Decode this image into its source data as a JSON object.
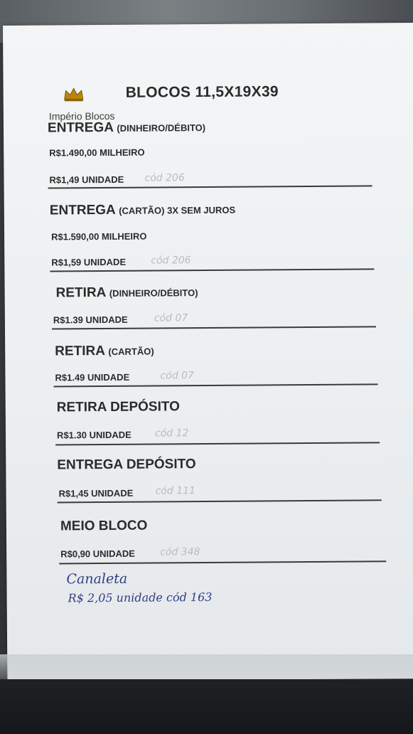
{
  "header": {
    "brand": "Império Blocos",
    "title": "BLOCOS 11,5X19X39",
    "logo_icon": "crown-icon"
  },
  "sections": [
    {
      "heading": "ENTREGA",
      "qualifier": "(DINHEIRO/DÉBITO)",
      "prices": [
        "R$1.490,00 MILHEIRO",
        "R$1,49 UNIDADE"
      ],
      "code": "cód 206"
    },
    {
      "heading": "ENTREGA",
      "qualifier": "(CARTÃO)  3X SEM JUROS",
      "prices": [
        "R$1.590,00 MILHEIRO",
        "R$1,59 UNIDADE"
      ],
      "code": "cód 206"
    },
    {
      "heading": "RETIRA",
      "qualifier": "(DINHEIRO/DÉBITO)",
      "prices": [
        "R$1.39 UNIDADE"
      ],
      "code": "cód 07"
    },
    {
      "heading": "RETIRA",
      "qualifier": "(CARTÃO)",
      "prices": [
        "R$1.49 UNIDADE"
      ],
      "code": "cód 07"
    },
    {
      "heading": "RETIRA DEPÓSITO",
      "qualifier": "",
      "prices": [
        "R$1.30 UNIDADE"
      ],
      "code": "cód 12"
    },
    {
      "heading": "ENTREGA DEPÓSITO",
      "qualifier": "",
      "prices": [
        "R$1,45 UNIDADE"
      ],
      "code": "cód 111"
    },
    {
      "heading": "MEIO BLOCO",
      "qualifier": "",
      "prices": [
        "R$0,90 UNIDADE"
      ],
      "code": "cód 348"
    }
  ],
  "handwritten": {
    "product": "Canaleta",
    "price_line": "R$ 2,05 unidade  cód 163"
  },
  "colors": {
    "ink_blue": "#2e3f86",
    "pencil_gray": "#b9bcbf",
    "print_black": "#2b2b2b"
  }
}
